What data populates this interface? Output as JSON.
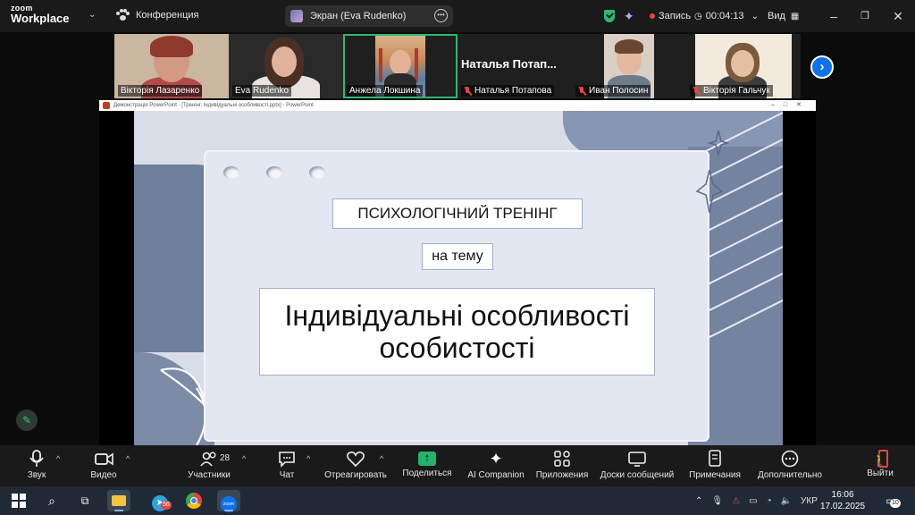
{
  "topbar": {
    "logo_line1": "zoom",
    "logo_line2": "Workplace",
    "conference_label": "Конференция",
    "screen_share_label": "Экран (Eva Rudenko)",
    "record_label": "Запись",
    "timer": "00:04:13",
    "view_label": "Вид"
  },
  "participants": [
    {
      "name": "Вікторія Лазаренко",
      "muted": false
    },
    {
      "name": "Eva Rudenko",
      "muted": false
    },
    {
      "name": "Анжела Локшина",
      "muted": false,
      "active": true
    },
    {
      "name": "Наталья Потапова",
      "display_big": "Наталья  Потап...",
      "muted": true
    },
    {
      "name": "Иван Полосин",
      "muted": true
    },
    {
      "name": "Вікторія Гальчук",
      "muted": true
    }
  ],
  "ppt": {
    "window_title": "Демонстрація PowerPoint - [Тренінг. Індивідуальні особливості.pptx] - PowerPoint"
  },
  "slide": {
    "box1": "ПСИХОЛОГІЧНИЙ ТРЕНІНГ",
    "box2": "на тему",
    "box3_line1": "Індивідуальні особливості",
    "box3_line2": "особистості"
  },
  "toolbar": {
    "audio": "Звук",
    "video": "Видео",
    "participants": "Участники",
    "participants_count": "28",
    "chat": "Чат",
    "react": "Отреагировать",
    "share": "Поделиться",
    "ai": "AI Companion",
    "apps": "Приложения",
    "whiteboards": "Доски сообщений",
    "notes": "Примечания",
    "more": "Дополнительно",
    "leave": "Выйти"
  },
  "taskbar": {
    "telegram_badge": "56",
    "lang": "УКР",
    "time": "16:06",
    "date": "17.02.2025",
    "notif_count": "10"
  },
  "colors": {
    "accent_green": "#2eb872",
    "zoom_blue": "#0e72ed",
    "alert_red": "#e8453c"
  }
}
